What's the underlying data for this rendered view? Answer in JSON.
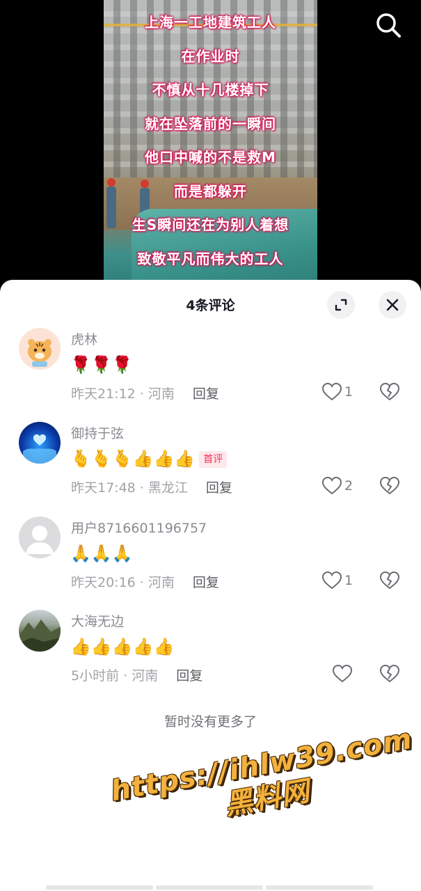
{
  "video": {
    "overlay_lines": [
      "上海一工地建筑工人",
      "在作业时",
      "不慎从十几楼掉下",
      "就在坠落前的一瞬间",
      "他口中喊的不是救M",
      "而是都躲开",
      "生S瞬间还在为别人着想",
      "致敬平凡而伟大的工人"
    ],
    "search_icon": "search-icon"
  },
  "sheet": {
    "title": "4条评论",
    "expand_icon": "expand-icon",
    "close_icon": "close-icon",
    "comments": [
      {
        "author": "虎林",
        "content": "🌹🌹🌹",
        "meta": "昨天21:12 · 河南",
        "reply": "回复",
        "likes": "1",
        "badge": ""
      },
      {
        "author": "御持于弦",
        "content": "🫰🫰🫰👍👍👍",
        "meta": "昨天17:48 · 黑龙江",
        "reply": "回复",
        "likes": "2",
        "badge": "首评"
      },
      {
        "author": "用户8716601196757",
        "content": "🙏🙏🙏",
        "meta": "昨天20:16 · 河南",
        "reply": "回复",
        "likes": "1",
        "badge": ""
      },
      {
        "author": "大海无边",
        "content": "👍👍👍👍👍",
        "meta": "5小时前 · 河南",
        "reply": "回复",
        "likes": "",
        "badge": ""
      }
    ],
    "no_more": "暂时没有更多了"
  },
  "watermark": {
    "url": "https://ihlw39.com",
    "name": "黑料网"
  },
  "colors": {
    "accent": "#fe2c55",
    "watermark": "#f3b23d",
    "overlay_glow": "#e0195b"
  }
}
